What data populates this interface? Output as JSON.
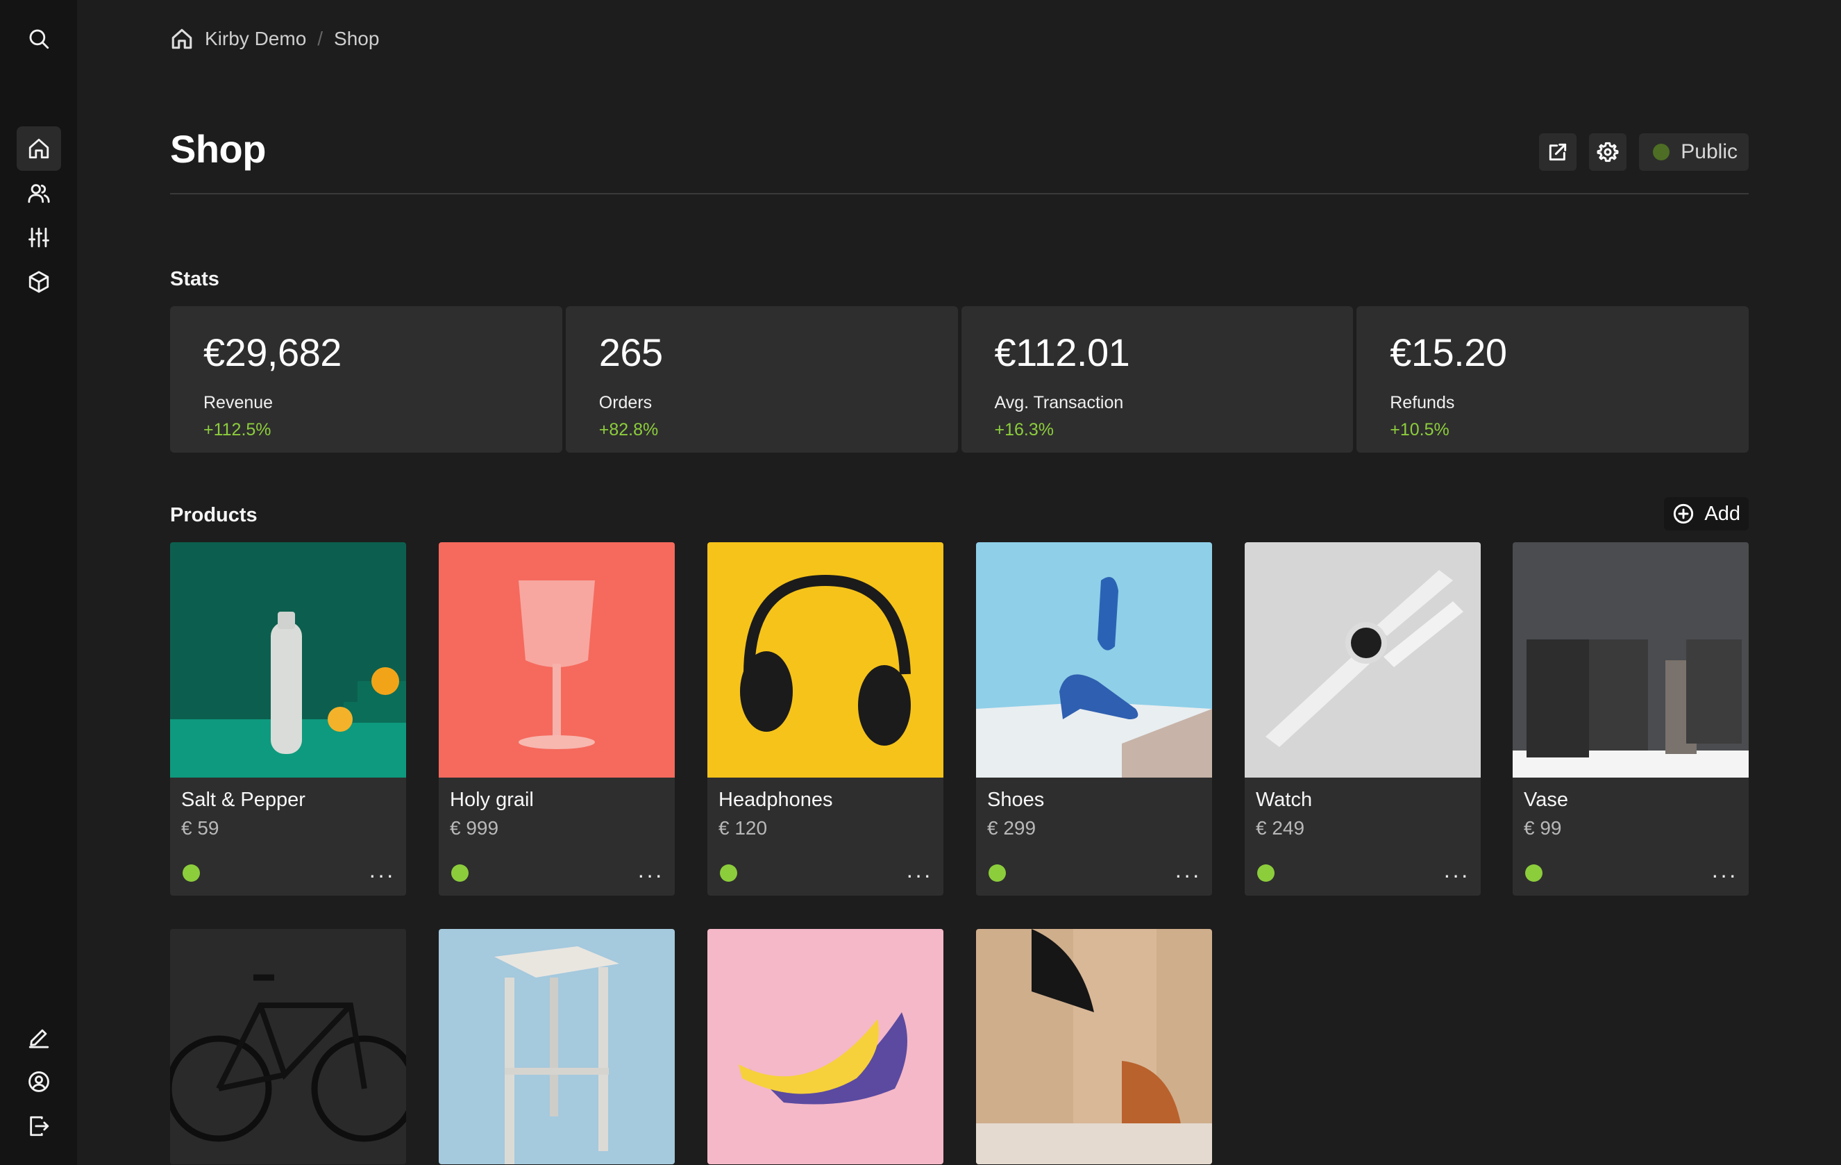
{
  "sidebar": {
    "top_icons": [
      "search-icon"
    ],
    "nav_icons": [
      "home-icon",
      "users-icon",
      "settings-sliders-icon",
      "box-icon"
    ],
    "bottom_icons": [
      "edit-icon",
      "account-icon",
      "logout-icon"
    ]
  },
  "breadcrumb": {
    "home": "Kirby Demo",
    "separator": "/",
    "current": "Shop"
  },
  "page": {
    "title": "Shop",
    "status_label": "Public"
  },
  "stats": {
    "label": "Stats",
    "items": [
      {
        "value": "€29,682",
        "label": "Revenue",
        "change": "+112.5%"
      },
      {
        "value": "265",
        "label": "Orders",
        "change": "+82.8%"
      },
      {
        "value": "€112.01",
        "label": "Avg. Transaction",
        "change": "+16.3%"
      },
      {
        "value": "€15.20",
        "label": "Refunds",
        "change": "+10.5%"
      }
    ]
  },
  "products": {
    "label": "Products",
    "add_label": "Add",
    "items": [
      {
        "name": "Salt & Pepper",
        "price": "€ 59",
        "more": "···"
      },
      {
        "name": "Holy grail",
        "price": "€ 999",
        "more": "···"
      },
      {
        "name": "Headphones",
        "price": "€ 120",
        "more": "···"
      },
      {
        "name": "Shoes",
        "price": "€ 299",
        "more": "···"
      },
      {
        "name": "Watch",
        "price": "€ 249",
        "more": "···"
      },
      {
        "name": "Vase",
        "price": "€ 99",
        "more": "···"
      }
    ]
  },
  "colors": {
    "accent_green": "#8ccd3c",
    "background": "#1d1d1d",
    "card": "#2e2e2e",
    "sidebar": "#141414"
  }
}
